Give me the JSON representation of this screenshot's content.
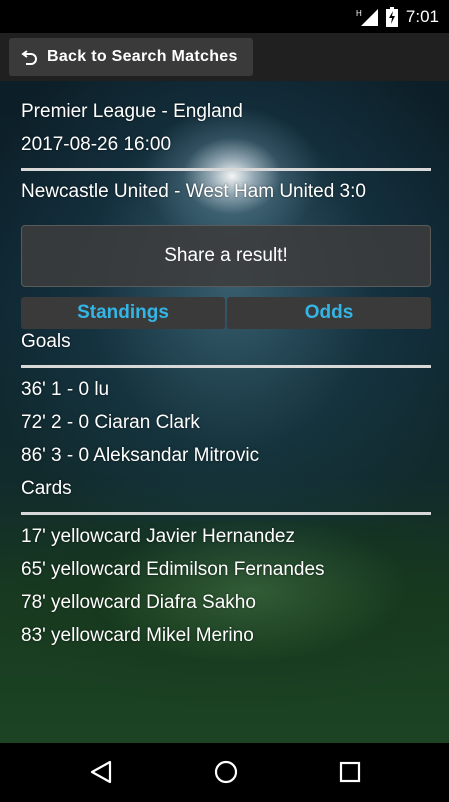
{
  "status_bar": {
    "time": "7:01"
  },
  "action_bar": {
    "back_label": "Back to Search Matches"
  },
  "match": {
    "league": "Premier League - England",
    "datetime": "2017-08-26 16:00",
    "teams_score": "Newcastle United - West Ham United 3:0"
  },
  "share_label": "Share a result!",
  "tabs": [
    {
      "label": "Standings"
    },
    {
      "label": "Odds"
    }
  ],
  "goals": {
    "header": "Goals",
    "items": [
      "36' 1 - 0 lu",
      "72' 2 - 0 Ciaran Clark",
      "86' 3 - 0 Aleksandar Mitrovic"
    ]
  },
  "cards": {
    "header": "Cards",
    "items": [
      "17' yellowcard Javier Hernandez",
      "65' yellowcard Edimilson Fernandes",
      "78' yellowcard Diafra Sakho",
      "83' yellowcard Mikel Merino"
    ]
  },
  "colors": {
    "accent": "#33b5e5",
    "action_bar": "#202020",
    "button": "#3a3a3a"
  }
}
